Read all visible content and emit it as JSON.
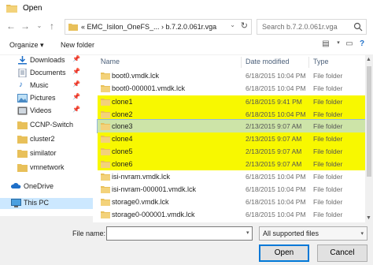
{
  "window": {
    "title": "Open"
  },
  "address": {
    "crumbs": "«  EMC_Isilon_OneFS_...  ›  b.7.2.0.061r.vga"
  },
  "search": {
    "placeholder": "Search b.7.2.0.061r.vga"
  },
  "toolbar": {
    "organize": "Organize ▾",
    "new_folder": "New folder"
  },
  "sidebar": {
    "items": [
      {
        "label": "Downloads",
        "icon": "downloads-icon",
        "pinned": true
      },
      {
        "label": "Documents",
        "icon": "documents-icon",
        "pinned": true
      },
      {
        "label": "Music",
        "icon": "music-icon",
        "pinned": true
      },
      {
        "label": "Pictures",
        "icon": "pictures-icon",
        "pinned": true
      },
      {
        "label": "Videos",
        "icon": "videos-icon",
        "pinned": true
      },
      {
        "label": "CCNP-Switch",
        "icon": "folder-icon",
        "pinned": false
      },
      {
        "label": "cluster2",
        "icon": "folder-icon",
        "pinned": false
      },
      {
        "label": "similator",
        "icon": "folder-icon",
        "pinned": false
      },
      {
        "label": "vmnetwork",
        "icon": "folder-icon",
        "pinned": false
      },
      {
        "label": "OneDrive",
        "icon": "onedrive-icon",
        "pinned": false
      },
      {
        "label": "This PC",
        "icon": "this-pc-icon",
        "pinned": false
      }
    ]
  },
  "columns": {
    "name": "Name",
    "date": "Date modified",
    "type": "Type"
  },
  "files": [
    {
      "name": "boot0.vmdk.lck",
      "date": "6/18/2015 10:04 PM",
      "type": "File folder",
      "state": "normal"
    },
    {
      "name": "boot0-000001.vmdk.lck",
      "date": "6/18/2015 10:04 PM",
      "type": "File folder",
      "state": "normal"
    },
    {
      "name": "clone1",
      "date": "6/18/2015 9:41 PM",
      "type": "File folder",
      "state": "highlight"
    },
    {
      "name": "clone2",
      "date": "6/18/2015 10:04 PM",
      "type": "File folder",
      "state": "highlight"
    },
    {
      "name": "clone3",
      "date": "2/13/2015 9:07 AM",
      "type": "File folder",
      "state": "selected"
    },
    {
      "name": "clone4",
      "date": "2/13/2015 9:07 AM",
      "type": "File folder",
      "state": "highlight"
    },
    {
      "name": "clone5",
      "date": "2/13/2015 9:07 AM",
      "type": "File folder",
      "state": "highlight"
    },
    {
      "name": "clone6",
      "date": "2/13/2015 9:07 AM",
      "type": "File folder",
      "state": "highlight"
    },
    {
      "name": "isi-nvram.vmdk.lck",
      "date": "6/18/2015 10:04 PM",
      "type": "File folder",
      "state": "normal"
    },
    {
      "name": "isi-nvram-000001.vmdk.lck",
      "date": "6/18/2015 10:04 PM",
      "type": "File folder",
      "state": "normal"
    },
    {
      "name": "storage0.vmdk.lck",
      "date": "6/18/2015 10:04 PM",
      "type": "File folder",
      "state": "normal"
    },
    {
      "name": "storage0-000001.vmdk.lck",
      "date": "6/18/2015 10:04 PM",
      "type": "File folder",
      "state": "normal"
    }
  ],
  "footer": {
    "file_name_label": "File name:",
    "file_name_value": "",
    "filter": "All supported files",
    "open": "Open",
    "cancel": "Cancel"
  },
  "colors": {
    "highlight": "#f8f800",
    "selected": "#cde4a8",
    "folder": "#e8c05a",
    "accent": "#0078d7"
  }
}
